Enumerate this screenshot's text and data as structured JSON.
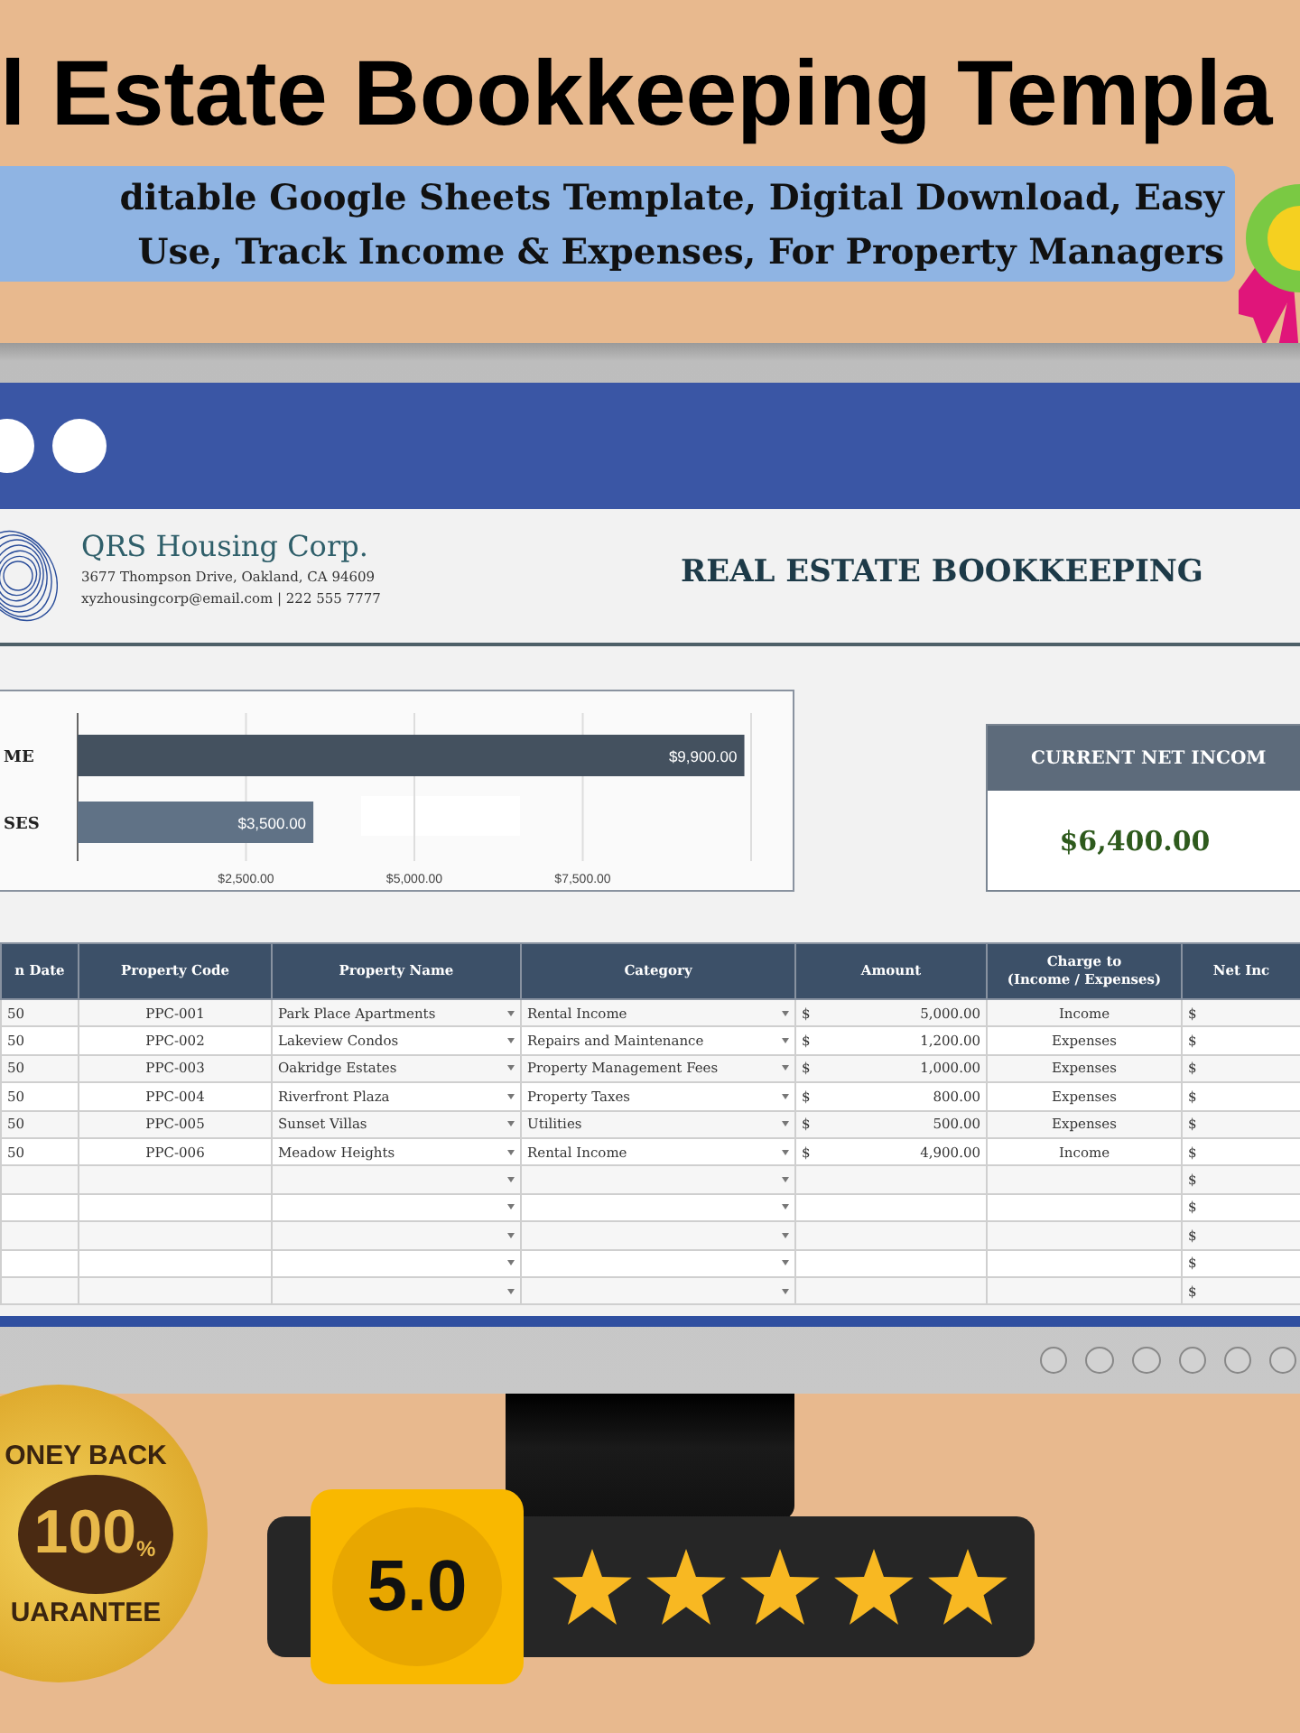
{
  "banner": {
    "title": "l Estate Bookkeeping Templa",
    "subtitle_lines": [
      "ditable Google Sheets Template, Digital Download, Easy",
      "Use, Track Income & Expenses, For Property Managers"
    ]
  },
  "sheet": {
    "company": {
      "name": "QRS Housing Corp.",
      "address": "3677 Thompson Drive, Oakland, CA 94609",
      "contact": "xyzhousingcorp@email.com | 222 555 7777"
    },
    "title": "REAL ESTATE BOOKKEEPING",
    "chart_data": {
      "type": "bar",
      "orientation": "horizontal",
      "grid": true,
      "categories": [
        "ME",
        "SES"
      ],
      "values": [
        9900,
        3500
      ],
      "value_labels": [
        "$9,900.00",
        "$3,500.00"
      ],
      "xlim": [
        0,
        10000
      ],
      "xticks": [
        {
          "value": 2500,
          "label": "$2,500.00"
        },
        {
          "value": 5000,
          "label": "$5,000.00"
        },
        {
          "value": 7500,
          "label": "$7,500.00"
        }
      ]
    },
    "net_income": {
      "label": "CURRENT NET INCOM",
      "value": "$6,400.00"
    },
    "table": {
      "columns": [
        "n Date",
        "Property Code",
        "Property Name",
        "Category",
        "Amount",
        "Charge to\n(Income / Expenses)",
        "Net Inc"
      ],
      "rows": [
        {
          "date": "50",
          "code": "PPC-001",
          "name": "Park Place Apartments",
          "category": "Rental Income",
          "currency": "$",
          "amount": "5,000.00",
          "charge_to": "Income",
          "net_currency": "$"
        },
        {
          "date": "50",
          "code": "PPC-002",
          "name": "Lakeview Condos",
          "category": "Repairs and Maintenance",
          "currency": "$",
          "amount": "1,200.00",
          "charge_to": "Expenses",
          "net_currency": "$"
        },
        {
          "date": "50",
          "code": "PPC-003",
          "name": "Oakridge Estates",
          "category": "Property Management Fees",
          "currency": "$",
          "amount": "1,000.00",
          "charge_to": "Expenses",
          "net_currency": "$"
        },
        {
          "date": "50",
          "code": "PPC-004",
          "name": "Riverfront Plaza",
          "category": "Property Taxes",
          "currency": "$",
          "amount": "800.00",
          "charge_to": "Expenses",
          "net_currency": "$"
        },
        {
          "date": "50",
          "code": "PPC-005",
          "name": "Sunset Villas",
          "category": "Utilities",
          "currency": "$",
          "amount": "500.00",
          "charge_to": "Expenses",
          "net_currency": "$"
        },
        {
          "date": "50",
          "code": "PPC-006",
          "name": "Meadow Heights",
          "category": "Rental Income",
          "currency": "$",
          "amount": "4,900.00",
          "charge_to": "Income",
          "net_currency": "$"
        },
        {
          "net_currency": "$"
        },
        {
          "net_currency": "$"
        },
        {
          "net_currency": "$"
        },
        {
          "net_currency": "$"
        },
        {
          "net_currency": "$"
        }
      ]
    }
  },
  "seal": {
    "top": "ONEY BACK",
    "number": "100",
    "percent": "%",
    "bottom": "UARANTEE"
  },
  "rating": {
    "score": "5.0",
    "stars": 5
  }
}
